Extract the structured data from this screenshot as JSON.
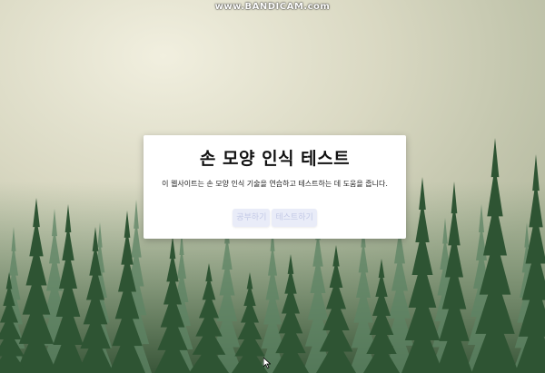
{
  "watermark": "www.BANDICAM.com",
  "card": {
    "title": "손 모양 인식 테스트",
    "description": "이 웹사이트는 손 모양 인식 기술을 연습하고 테스트하는 데 도움을 줍니다."
  },
  "buttons": {
    "study": "공부하기",
    "test": "테스트하기"
  },
  "colors": {
    "button_bg": "#e9ecf8",
    "button_text": "#c3c9e6",
    "forest_dark": "#1f3d22",
    "fog": "#e3e2cf"
  },
  "icons": {
    "cursor": "mouse-pointer-icon"
  }
}
